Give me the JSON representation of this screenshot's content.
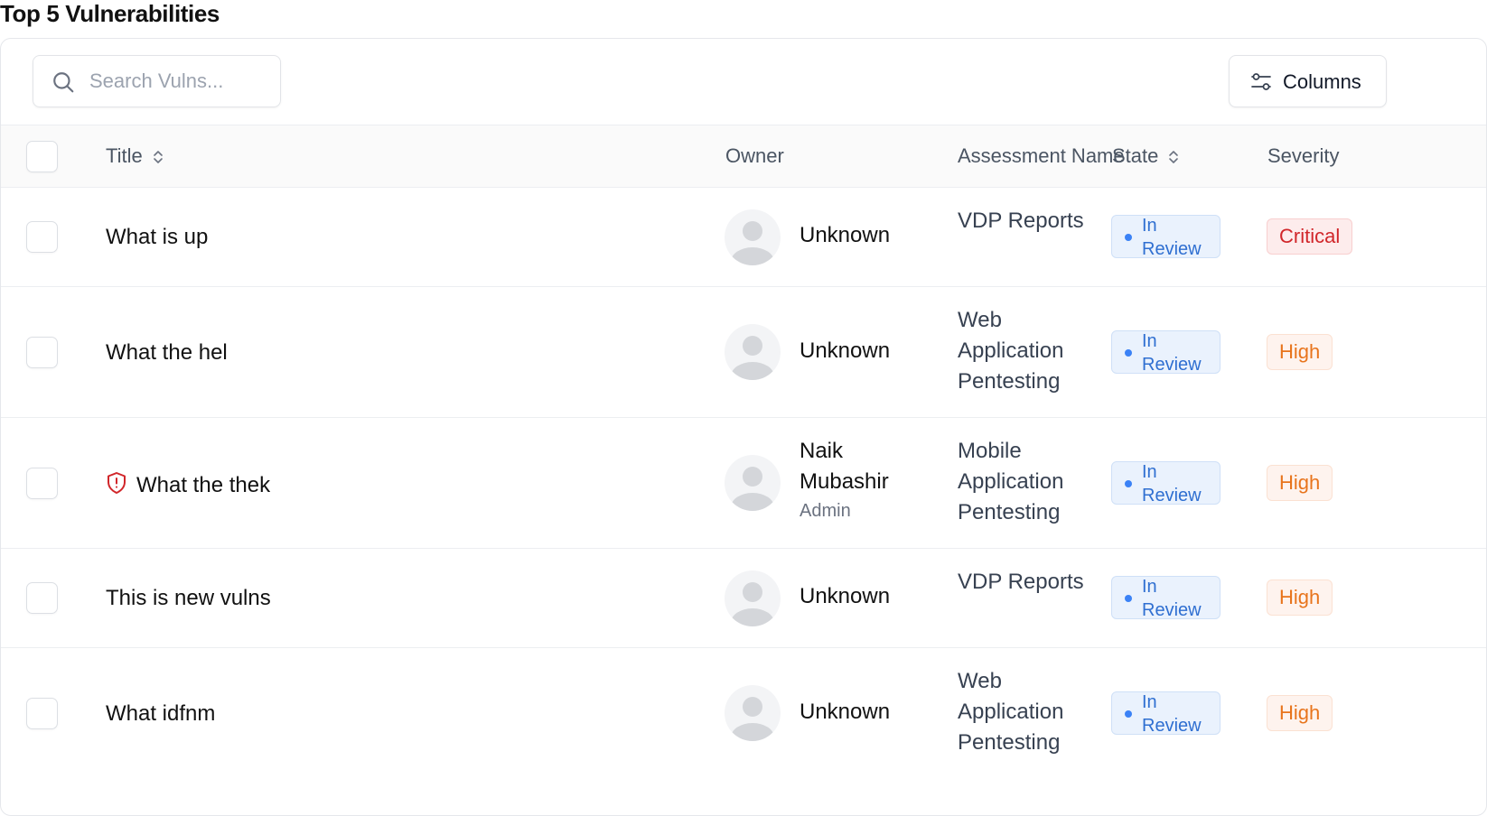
{
  "page": {
    "title": "Top 5 Vulnerabilities"
  },
  "toolbar": {
    "search_placeholder": "Search Vulns...",
    "columns_label": "Columns"
  },
  "table": {
    "headers": {
      "title": "Title",
      "owner": "Owner",
      "assessment": "Assessment Name",
      "state": "State",
      "severity": "Severity"
    },
    "rows": [
      {
        "title": "What is up",
        "flagged": false,
        "owner": "Unknown",
        "owner_role": "",
        "assessment": "VDP Reports",
        "state": "In Review",
        "severity": "Critical"
      },
      {
        "title": "What the hel",
        "flagged": false,
        "owner": "Unknown",
        "owner_role": "",
        "assessment": "Web Application Pentesting",
        "state": "In Review",
        "severity": "High"
      },
      {
        "title": "What the thek",
        "flagged": true,
        "owner": "Naik Mubashir",
        "owner_role": "Admin",
        "assessment": "Mobile Application Pentesting",
        "state": "In Review",
        "severity": "High"
      },
      {
        "title": "This is new vulns",
        "flagged": false,
        "owner": "Unknown",
        "owner_role": "",
        "assessment": "VDP Reports",
        "state": "In Review",
        "severity": "High"
      },
      {
        "title": "What idfnm",
        "flagged": false,
        "owner": "Unknown",
        "owner_role": "",
        "assessment": "Web Application Pentesting",
        "state": "In Review",
        "severity": "High"
      }
    ]
  },
  "colors": {
    "critical_text": "#d1262a",
    "high_text": "#e8741c",
    "state_text": "#2f6fd1",
    "flag_icon": "#d1262a"
  }
}
